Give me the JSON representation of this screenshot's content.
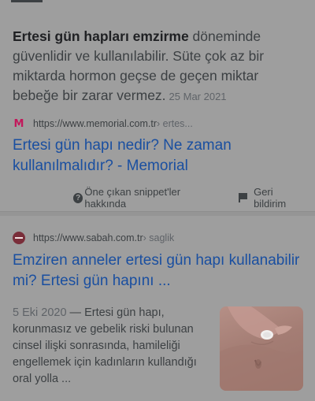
{
  "snippet": {
    "bold": "Ertesi gün hapları emzirme",
    "text": " döneminde güvenlidir ve kullanılabilir. Süte çok az bir miktarda hormon geçse de geçen miktar bebeğe bir zarar vermez.",
    "date": "25 Mar 2021"
  },
  "result1": {
    "favicon": "memorial-favicon",
    "url": "https://www.memorial.com.tr",
    "path": " › ertes...",
    "title": "Ertesi gün hapı nedir? Ne zaman kullanılmalıdır? - Memorial"
  },
  "footer": {
    "featured_snippets": "Öne çıkan snippet'ler hakkında",
    "feedback": "Geri bildirim"
  },
  "result2": {
    "favicon": "sabah-favicon",
    "url": "https://www.sabah.com.tr",
    "path": " › saglik",
    "title": "Emziren anneler ertesi gün hapı kullanabilir mi? Ertesi gün hapını ...",
    "date": "5 Eki 2020",
    "dash": " — ",
    "text": "Ertesi gün hapı, korunmasız ve gebelik riski bulunan cinsel ilişki sonrasında, hamileliği engellemek için kadınların kullandığı oral yolla ..."
  },
  "colors": {
    "link": "#1a4fa0",
    "background": "#9e9e9e",
    "text": "#3c4043"
  }
}
